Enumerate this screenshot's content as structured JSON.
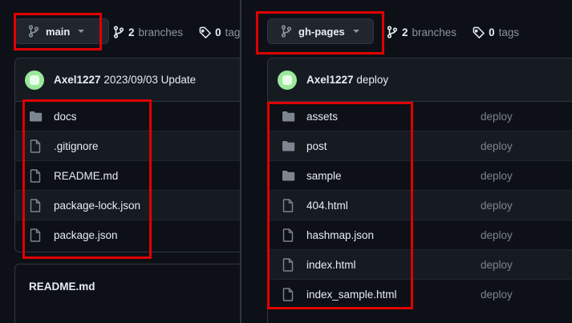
{
  "left": {
    "branch": "main",
    "branches_count": "2",
    "branches_label": "branches",
    "tags_count": "0",
    "tags_label": "tags",
    "commit_author": "Axel1227",
    "commit_message": "2023/09/03 Update",
    "files": [
      {
        "name": "docs",
        "type": "folder"
      },
      {
        "name": ".gitignore",
        "type": "file"
      },
      {
        "name": "README.md",
        "type": "file"
      },
      {
        "name": "package-lock.json",
        "type": "file"
      },
      {
        "name": "package.json",
        "type": "file"
      }
    ],
    "readme_title": "README.md"
  },
  "right": {
    "branch": "gh-pages",
    "branches_count": "2",
    "branches_label": "branches",
    "tags_count": "0",
    "tags_label": "tags",
    "commit_author": "Axel1227",
    "commit_message": "deploy",
    "files": [
      {
        "name": "assets",
        "type": "folder",
        "message": "deploy"
      },
      {
        "name": "post",
        "type": "folder",
        "message": "deploy"
      },
      {
        "name": "sample",
        "type": "folder",
        "message": "deploy"
      },
      {
        "name": "404.html",
        "type": "file",
        "message": "deploy"
      },
      {
        "name": "hashmap.json",
        "type": "file",
        "message": "deploy"
      },
      {
        "name": "index.html",
        "type": "file",
        "message": "deploy"
      },
      {
        "name": "index_sample.html",
        "type": "file",
        "message": "deploy"
      }
    ]
  },
  "colors": {
    "background": "#0d1117",
    "border": "#30363d",
    "highlight": "#e00000",
    "folder_icon": "#7d8590",
    "muted_text": "#8b949e"
  },
  "icons": {
    "branch": "git-branch-icon",
    "tag": "tag-icon",
    "folder": "folder-icon",
    "file": "file-icon"
  }
}
